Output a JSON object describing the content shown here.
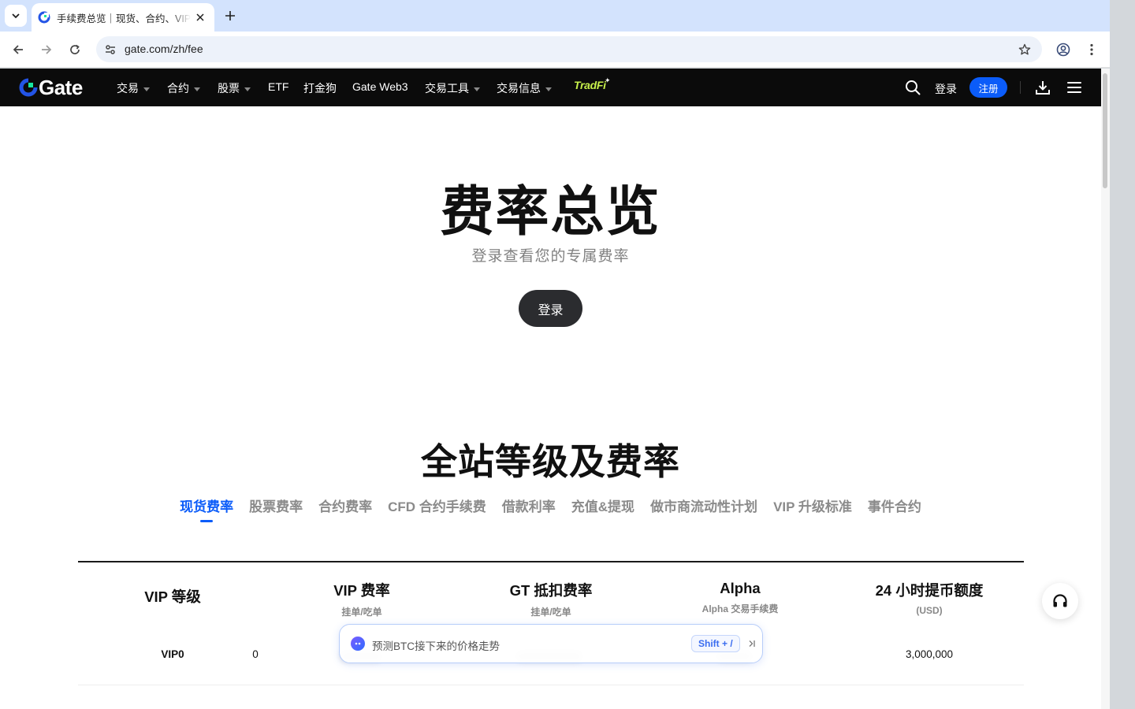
{
  "browser": {
    "tab_title": "手续费总览｜现货、合约、VIP",
    "url": "gate.com/zh/fee"
  },
  "nav": {
    "logo_text": "Gate",
    "items": [
      {
        "label": "交易",
        "dropdown": true
      },
      {
        "label": "合约",
        "dropdown": true
      },
      {
        "label": "股票",
        "dropdown": true
      },
      {
        "label": "ETF",
        "dropdown": false
      },
      {
        "label": "打金狗",
        "dropdown": false
      },
      {
        "label": "Gate Web3",
        "dropdown": false
      },
      {
        "label": "交易工具",
        "dropdown": true
      },
      {
        "label": "交易信息",
        "dropdown": true
      }
    ],
    "tradfi_label": "TradFi",
    "login_label": "登录",
    "register_label": "注册"
  },
  "hero": {
    "title": "费率总览",
    "subtitle": "登录查看您的专属费率",
    "login_button": "登录"
  },
  "section": {
    "title": "全站等级及费率",
    "tabs": [
      "现货费率",
      "股票费率",
      "合约费率",
      "CFD 合约手续费",
      "借款利率",
      "充值&提现",
      "做市商流动性计划",
      "VIP 升级标准",
      "事件合约"
    ],
    "active_tab": "现货费率"
  },
  "table": {
    "columns": [
      {
        "title": "VIP 等级",
        "sub": ""
      },
      {
        "title": "VIP 费率",
        "sub": "挂单/吃单"
      },
      {
        "title": "GT 抵扣费率",
        "sub": "挂单/吃单"
      },
      {
        "title": "Alpha",
        "sub": "Alpha 交易手续费"
      },
      {
        "title": "24 小时提币额度",
        "sub": "(USD)"
      }
    ],
    "rows": [
      {
        "level": "VIP0",
        "vip_rate_partial": "0",
        "withdraw_limit": "3,000,000"
      }
    ]
  },
  "ai_bar": {
    "placeholder": "预测BTC接下来的价格走势",
    "shortcut": "Shift + /"
  },
  "colors": {
    "brand_blue": "#0b5cf9",
    "nav_bg": "#0b0b0b",
    "tradfi_green": "#c7f04b"
  }
}
